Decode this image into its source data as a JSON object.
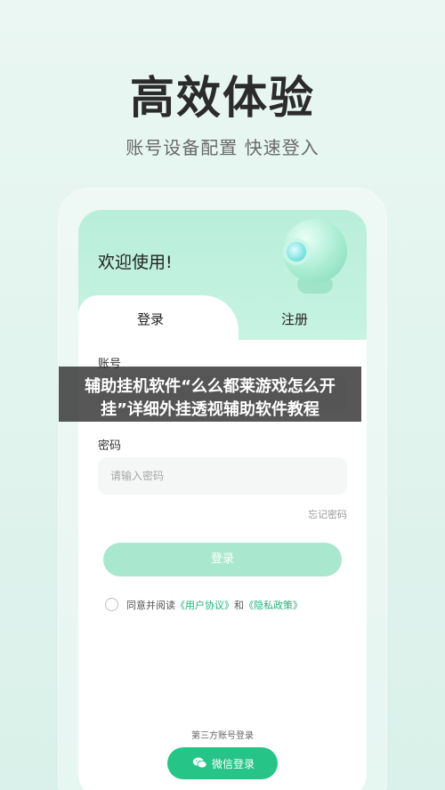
{
  "hero": {
    "title": "高效体验",
    "subtitle": "账号设备配置 快速登入"
  },
  "card": {
    "welcome": "欢迎使用!",
    "tabs": {
      "login": "登录",
      "register": "注册"
    },
    "account_label": "账号",
    "password_label": "密码",
    "password_placeholder": "请输入密码",
    "forgot_password": "忘记密码",
    "login_button": "登录",
    "agreement_prefix": "同意并阅读",
    "user_agreement": "《用户协议》",
    "and": "和",
    "privacy_policy": "《隐私政策》",
    "third_party_title": "第三方账号登录",
    "wechat_login": "微信登录"
  },
  "overlay": {
    "line1": "辅助挂机软件“么么都莱游戏怎么开",
    "line2": "挂”详细外挂透视辅助软件教程"
  },
  "colors": {
    "accent": "#27c487",
    "link": "#21b37f",
    "header": "#b8efda"
  }
}
